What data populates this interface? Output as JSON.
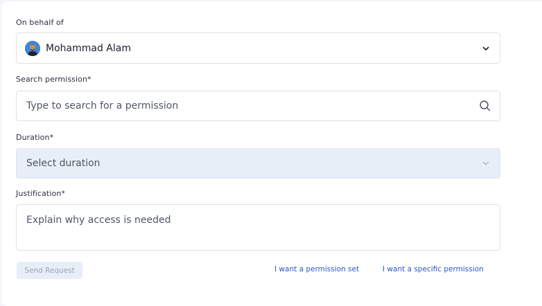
{
  "form": {
    "on_behalf_label": "On behalf of",
    "selected_user": "Mohammad Alam",
    "search_label": "Search permission*",
    "search_placeholder": "Type to search for a permission",
    "duration_label": "Duration*",
    "duration_placeholder": "Select duration",
    "justification_label": "Justification*",
    "justification_placeholder": "Explain why access is needed"
  },
  "actions": {
    "send_label": "Send Request",
    "permission_set_link": "I want a permission set",
    "specific_permission_link": "I want a specific permission"
  },
  "colors": {
    "link": "#2858c7",
    "disabled_field_bg": "#e8eef8",
    "disabled_button_text": "#9aa6b8"
  },
  "icons": {
    "user_dropdown": "chevron-down-icon",
    "search": "search-icon",
    "duration_dropdown": "chevron-down-icon",
    "avatar": "user-avatar"
  }
}
